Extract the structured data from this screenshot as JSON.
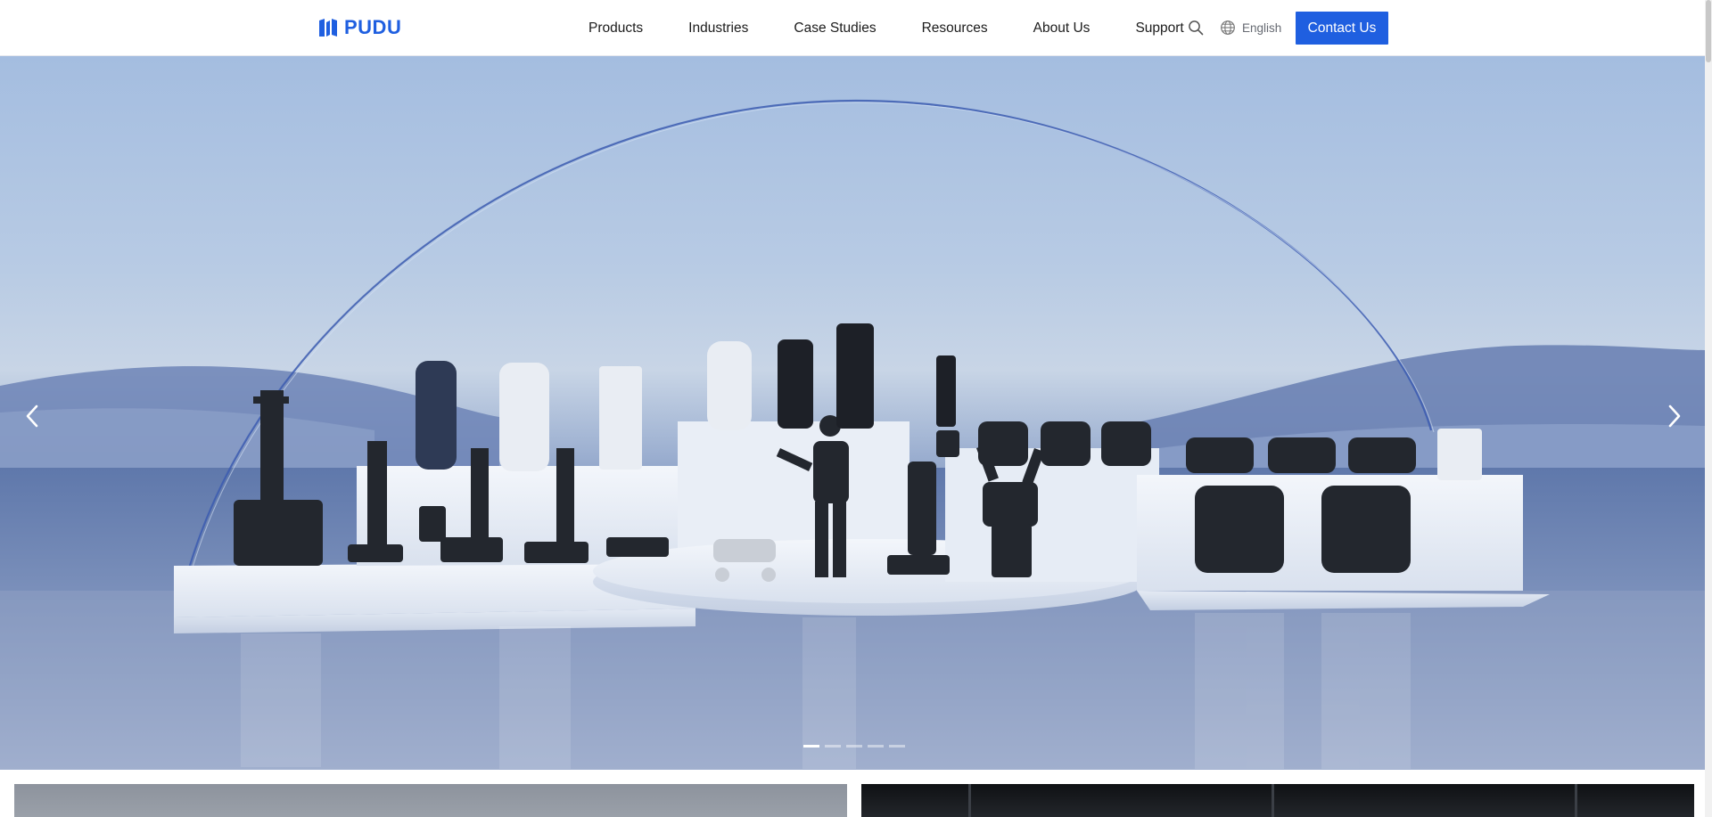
{
  "header": {
    "logo_text": "PUDU",
    "logo_icon": "pudu-logo-mark",
    "nav": [
      {
        "label": "Products"
      },
      {
        "label": "Industries"
      },
      {
        "label": "Case Studies"
      },
      {
        "label": "Resources"
      },
      {
        "label": "About Us"
      },
      {
        "label": "Support"
      }
    ],
    "search_icon": "search-icon",
    "language": {
      "icon": "globe-icon",
      "label": "English"
    },
    "contact_button": "Contact Us"
  },
  "hero": {
    "image": "hero-robot-lineup-showroom",
    "prev_icon": "chevron-left-icon",
    "next_icon": "chevron-right-icon",
    "slides_total": 5,
    "active_slide": 1
  },
  "cards": [
    {
      "name": "feature-card-1"
    },
    {
      "name": "feature-card-2"
    }
  ],
  "colors": {
    "brand": "#1f5fe0",
    "nav_text": "#1c1c1c",
    "lang_text": "#666a72"
  }
}
